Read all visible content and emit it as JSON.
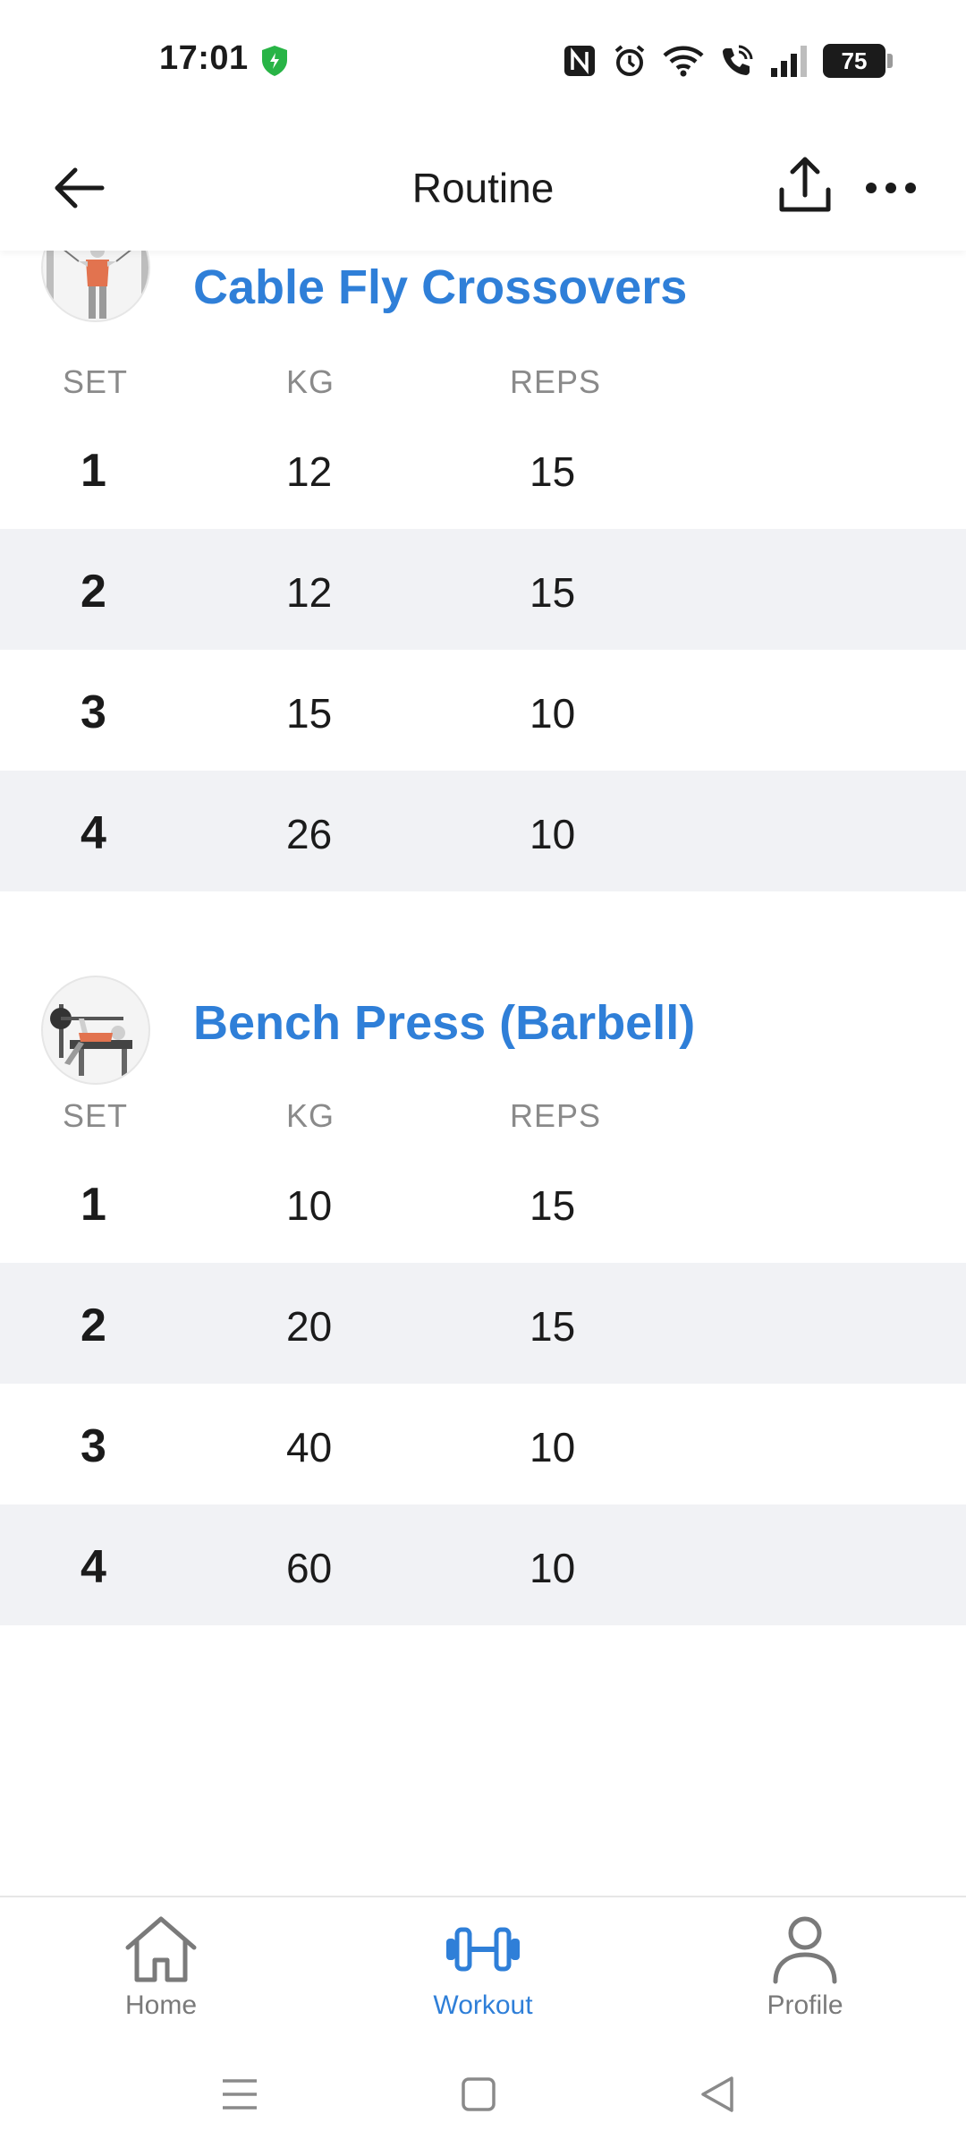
{
  "status_bar": {
    "time": "17:01",
    "battery": "75",
    "icons": [
      "shield-icon",
      "nfc-icon",
      "alarm-icon",
      "wifi-icon",
      "wifi-call-icon",
      "signal-icon",
      "battery-icon"
    ]
  },
  "header": {
    "title": "Routine",
    "icons": [
      "back-arrow-icon",
      "share-icon",
      "more-icon"
    ]
  },
  "exercises": [
    {
      "name": "Cable Fly Crossovers",
      "columns": {
        "set": "SET",
        "kg": "KG",
        "reps": "REPS"
      },
      "sets": [
        {
          "set": "1",
          "kg": "12",
          "reps": "15"
        },
        {
          "set": "2",
          "kg": "12",
          "reps": "15"
        },
        {
          "set": "3",
          "kg": "15",
          "reps": "10"
        },
        {
          "set": "4",
          "kg": "26",
          "reps": "10"
        }
      ]
    },
    {
      "name": "Bench Press (Barbell)",
      "columns": {
        "set": "SET",
        "kg": "KG",
        "reps": "REPS"
      },
      "sets": [
        {
          "set": "1",
          "kg": "10",
          "reps": "15"
        },
        {
          "set": "2",
          "kg": "20",
          "reps": "15"
        },
        {
          "set": "3",
          "kg": "40",
          "reps": "10"
        },
        {
          "set": "4",
          "kg": "60",
          "reps": "10"
        }
      ]
    }
  ],
  "bottom_nav": {
    "items": [
      {
        "label": "Home",
        "icon": "home-icon",
        "active": false
      },
      {
        "label": "Workout",
        "icon": "dumbbell-icon",
        "active": true
      },
      {
        "label": "Profile",
        "icon": "person-icon",
        "active": false
      }
    ]
  },
  "colors": {
    "accent": "#2f7fd8",
    "row_alt": "#f1f2f5",
    "muted_text": "#8a8a8a"
  }
}
